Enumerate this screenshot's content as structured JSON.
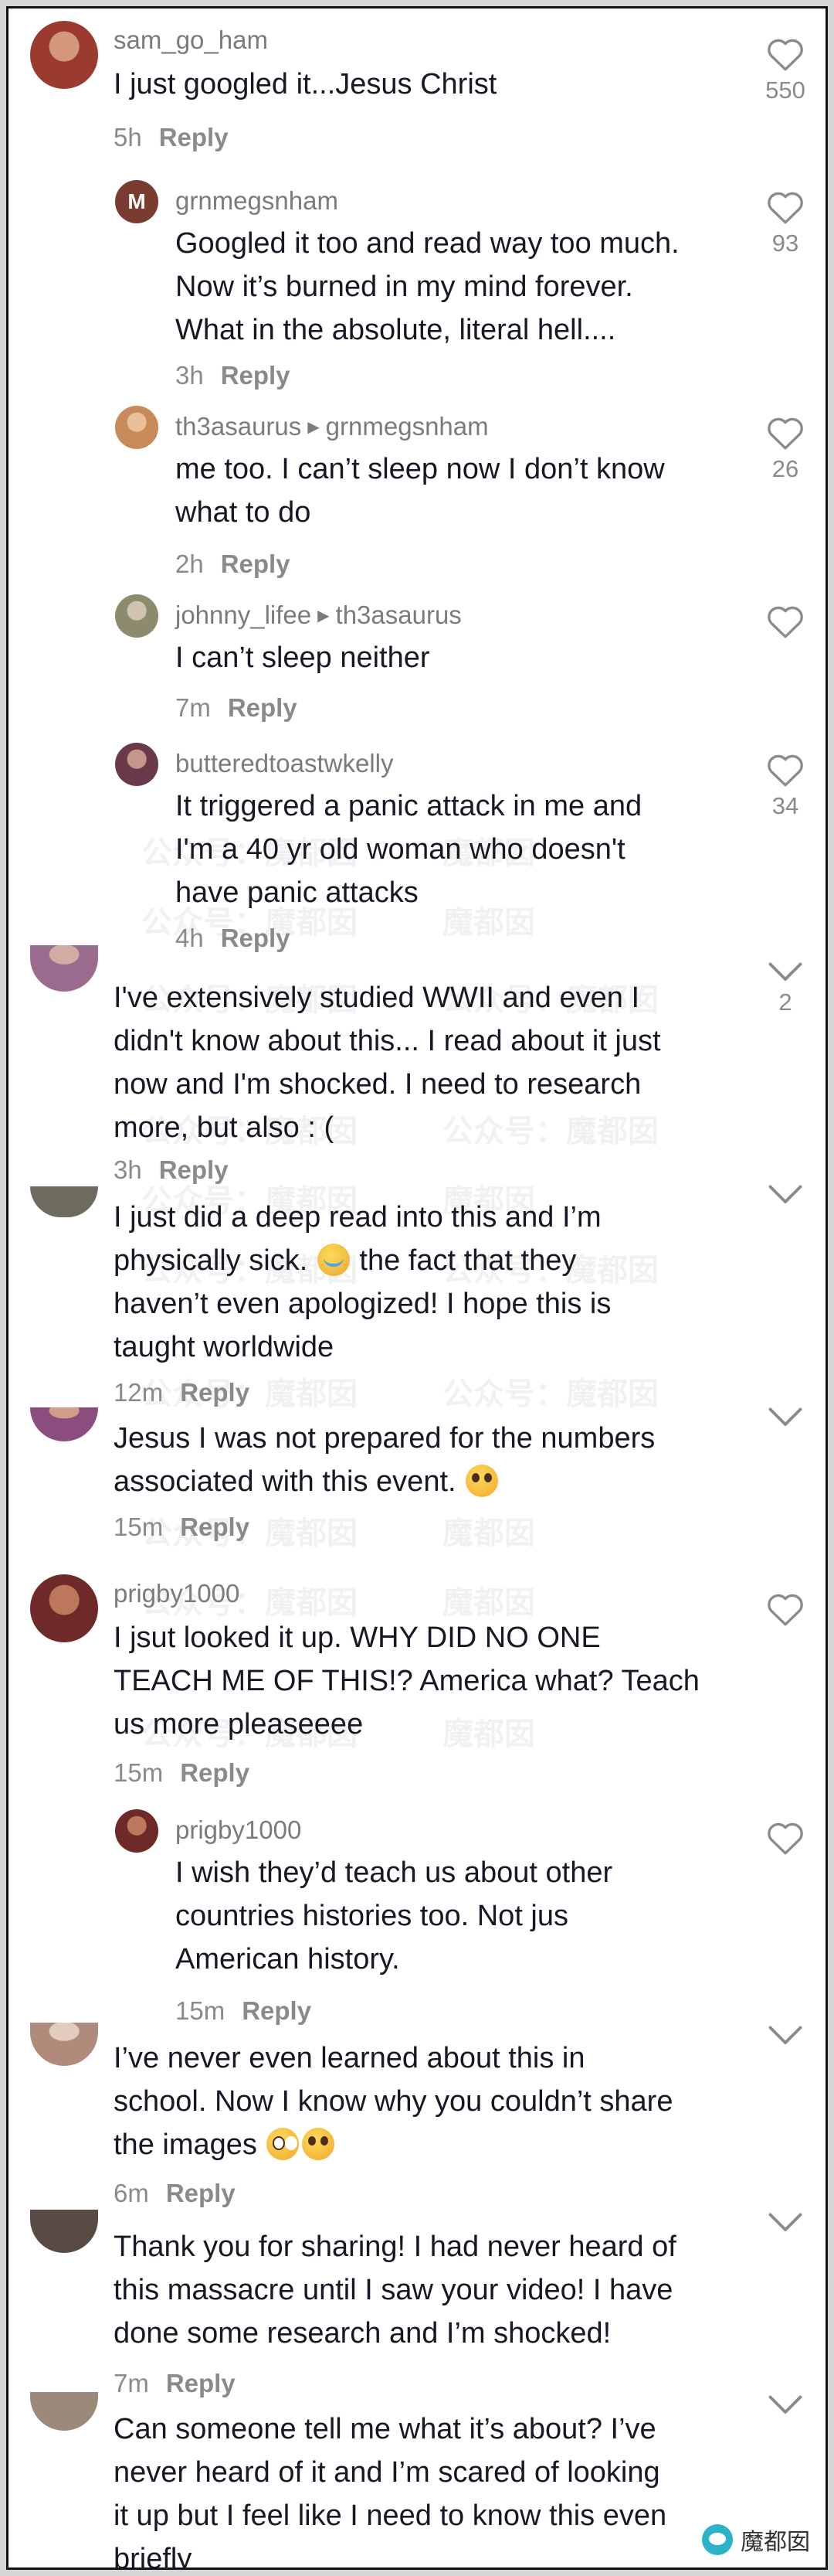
{
  "colors": {
    "text": "#161823",
    "muted": "#8a8a8a",
    "username": "#7b7b7b",
    "background": "#ffffff"
  },
  "watermark": {
    "text_a": "公众号：魔都囡",
    "text_b": "公众号：",
    "text_c": "魔都囡",
    "corner": "魔都囡"
  },
  "comments": [
    {
      "username": "sam_go_ham",
      "text": "I just googled it...Jesus Christ",
      "time": "5h",
      "reply": "Reply",
      "likes": "550",
      "avatar_color": "#9b3b2f",
      "icon": "heart-icon"
    },
    {
      "username": "grnmegsnham",
      "avatar_letter": "M",
      "text": "Googled it too and read way too much.\nNow it’s burned in my mind forever.\nWhat in the absolute, literal hell....",
      "time": "3h",
      "reply": "Reply",
      "likes": "93",
      "avatar_color": "#7a3b30",
      "icon": "heart-icon"
    },
    {
      "username": "th3asaurus",
      "reply_to": "grnmegsnham",
      "text": "me too. I can’t sleep now I don’t know\nwhat to do",
      "time": "2h",
      "reply": "Reply",
      "likes": "26",
      "avatar_color": "#c78a5a",
      "icon": "heart-icon"
    },
    {
      "username": "johnny_lifee",
      "reply_to": "th3asaurus",
      "text": "I can’t sleep neither",
      "time": "7m",
      "reply": "Reply",
      "likes": "",
      "avatar_color": "#8d8b6e",
      "icon": "heart-icon"
    },
    {
      "username": "butteredtoastwkelly",
      "text": "It triggered a panic attack in me and\nI'm a 40 yr old woman who doesn't\nhave panic attacks",
      "time": "4h",
      "reply": "Reply",
      "likes": "34",
      "avatar_color": "#6b3a4a",
      "icon": "heart-icon"
    },
    {
      "username": "",
      "text": "I've extensively studied WWII and even I\ndidn't know about this... I read about it just\nnow and I'm shocked. I need to research\nmore, but also : (",
      "time": "3h",
      "reply": "Reply",
      "likes": "2",
      "avatar_color": "#9b6b8e",
      "icon": "chevron-down-icon"
    },
    {
      "username": "",
      "text_before": "I just did a deep read into this and I’m\nphysically sick. ",
      "text_after": " the fact that they\nhaven’t even apologized! I hope this is\ntaught worldwide",
      "time": "12m",
      "reply": "Reply",
      "likes": "",
      "avatar_color": "#6e6a5e",
      "icon": "chevron-down-icon"
    },
    {
      "username": "",
      "text_before": "Jesus I was not prepared for the numbers\nassociated with this event. ",
      "text_after": "",
      "time": "15m",
      "reply": "Reply",
      "likes": "",
      "avatar_color": "#8a4d7e",
      "icon": "chevron-down-icon"
    },
    {
      "username": "prigby1000",
      "text": "I jsut looked it up. WHY DID NO ONE\nTEACH ME OF THIS!? America what? Teach\nus more pleaseeee",
      "time": "15m",
      "reply": "Reply",
      "likes": "",
      "avatar_color": "#6e2a28",
      "icon": "heart-icon"
    },
    {
      "username": "prigby1000",
      "text": "I wish they’d teach us about other\ncountries histories too. Not jus\nAmerican history.",
      "time": "15m",
      "reply": "Reply",
      "likes": "",
      "avatar_color": "#6e2a28",
      "icon": "heart-icon"
    },
    {
      "username": "",
      "text_before": "I’ve never even learned about this in\nschool. Now I know why you couldn’t share\nthe images ",
      "text_after": "",
      "time": "6m",
      "reply": "Reply",
      "likes": "",
      "avatar_color": "#b08a7a",
      "icon": "chevron-down-icon"
    },
    {
      "username": "",
      "text": "Thank you for sharing! I had never heard of\nthis massacre until I saw your video! I have\ndone some research and I’m shocked!",
      "time": "7m",
      "reply": "Reply",
      "likes": "",
      "avatar_color": "#5a4a44",
      "icon": "chevron-down-icon"
    },
    {
      "username": "",
      "text": "Can someone tell me what it’s about? I’ve\nnever heard of it and I’m scared of looking\nit up but I feel like I need to know this even\nbriefly",
      "time": "",
      "reply": "",
      "likes": "",
      "avatar_color": "#9b8a7a",
      "icon": "chevron-down-icon"
    }
  ]
}
